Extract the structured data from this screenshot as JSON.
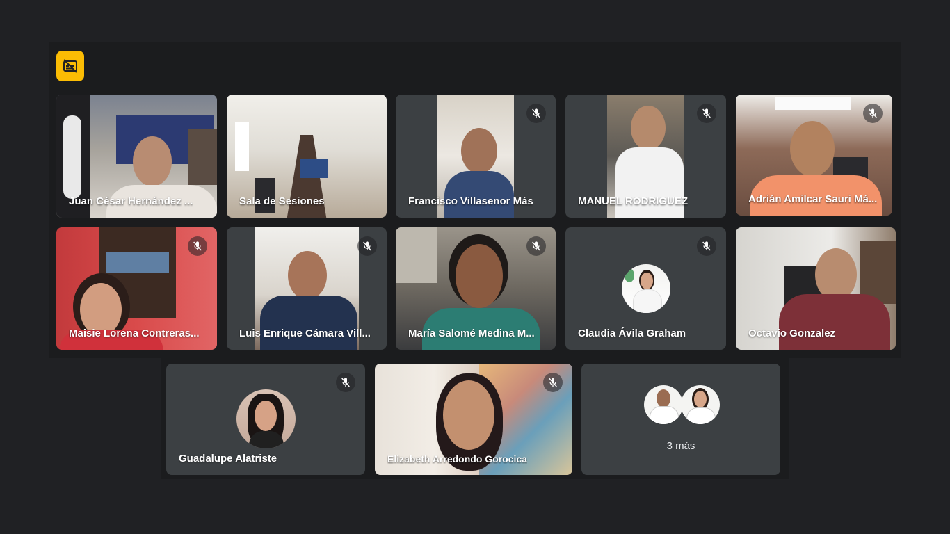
{
  "meeting": {
    "captions_button_icon": "captions-off-icon",
    "accent_color": "#fbbc04",
    "mic_off_icon": "mic-off-icon"
  },
  "participants": [
    {
      "name": "Juan César Hernández ...",
      "muted": false
    },
    {
      "name": "Sala de Sesiones",
      "muted": false
    },
    {
      "name": "Francisco Villasenor Más",
      "muted": true
    },
    {
      "name": "MANUEL RODRIGUEZ",
      "muted": true
    },
    {
      "name": "Adrián Amilcar Sauri Má...",
      "muted": true
    },
    {
      "name": "Maisie Lorena Contreras...",
      "muted": true
    },
    {
      "name": "Luis Enrique Cámara Vill...",
      "muted": true
    },
    {
      "name": "María Salomé Medina M...",
      "muted": true
    },
    {
      "name": "Claudia Ávila Graham",
      "muted": true
    },
    {
      "name": "Octavio Gonzalez",
      "muted": false
    },
    {
      "name": "Guadalupe Alatriste",
      "muted": true
    },
    {
      "name": "Elizabeth Arredondo Gorocica",
      "muted": true
    }
  ],
  "overflow": {
    "label": "3 más"
  }
}
